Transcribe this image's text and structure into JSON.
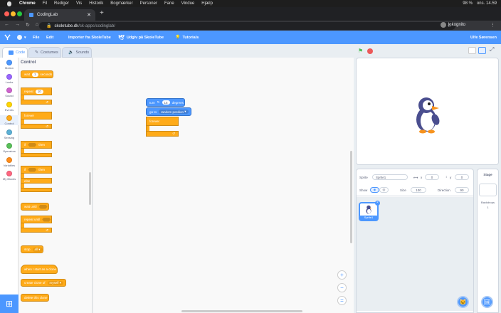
{
  "mac": {
    "app": "Chrome",
    "menus": [
      "Fil",
      "Rediger",
      "Vis",
      "Historik",
      "Bogmærker",
      "Personer",
      "Fane",
      "Vindue",
      "Hjælp"
    ],
    "battery": "98 %",
    "clock": "ons. 14.59"
  },
  "browser": {
    "tab_title": "CodingLab",
    "url_domain": "skoletube.dk",
    "url_path": "/sk-apps/codinglab/",
    "profile": "Inkognito"
  },
  "header": {
    "file": "File",
    "edit": "Edit",
    "import": "Importer fra SkoleTube",
    "upload": "Udgiv på SkoleTube",
    "tutorials": "Tutorials",
    "user": "Ulfe Sørensen"
  },
  "editor_tabs": {
    "code": "Code",
    "costumes": "Costumes",
    "sounds": "Sounds"
  },
  "categories": [
    {
      "label": "Motion",
      "color": "#4c97ff"
    },
    {
      "label": "Looks",
      "color": "#9966ff"
    },
    {
      "label": "Sound",
      "color": "#cf63cf"
    },
    {
      "label": "Events",
      "color": "#ffd500"
    },
    {
      "label": "Control",
      "color": "#ffab19"
    },
    {
      "label": "Sensing",
      "color": "#5cb1d6"
    },
    {
      "label": "Operators",
      "color": "#59c059"
    },
    {
      "label": "Variables",
      "color": "#ff8c1a"
    },
    {
      "label": "My Blocks",
      "color": "#ff6680"
    }
  ],
  "palette": {
    "title": "Control",
    "wait": "wait",
    "wait_val": "1",
    "seconds": "seconds",
    "repeat": "repeat",
    "repeat_val": "10",
    "forever": "forever",
    "if": "if",
    "then": "then",
    "if2": "if",
    "then2": "then",
    "else": "else",
    "wait_until": "wait until",
    "repeat_until": "repeat until",
    "stop": "stop",
    "stop_val": "all",
    "when_clone": "when I start as a clone",
    "create_clone": "create clone of",
    "create_clone_val": "myself",
    "delete_clone": "delete this clone"
  },
  "script": {
    "turn": "turn",
    "turn_val": "15",
    "degrees": "degrees",
    "goto": "go to",
    "goto_val": "random position",
    "forever": "forever"
  },
  "zoom": {
    "in": "+",
    "out": "−",
    "reset": "="
  },
  "sprite_info": {
    "sprite_label": "Sprite",
    "sprite_name": "Sprite1",
    "x_label": "x",
    "x_val": "0",
    "y_label": "y",
    "y_val": "0",
    "show_label": "Show",
    "size_label": "Size",
    "size_val": "100",
    "direction_label": "Direction",
    "direction_val": "90"
  },
  "sprites": [
    {
      "name": "Sprite1"
    }
  ],
  "stage_panel": {
    "title": "Stage",
    "backdrops_label": "Backdrops",
    "backdrops_count": "1"
  }
}
